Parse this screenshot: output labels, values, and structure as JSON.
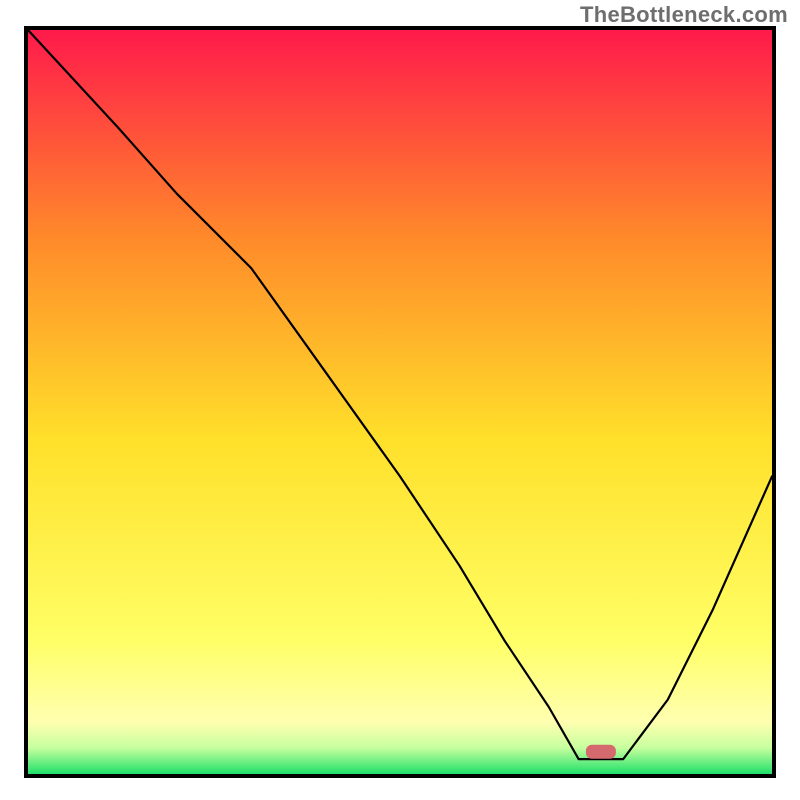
{
  "watermark": "TheBottleneck.com",
  "chart_data": {
    "type": "line",
    "title": "",
    "xlabel": "",
    "ylabel": "",
    "xlim": [
      0,
      100
    ],
    "ylim": [
      0,
      100
    ],
    "grid": false,
    "gradient_colors": {
      "top": "#ff1a4b",
      "upper_mid": "#ff8a2a",
      "mid": "#ffe02a",
      "lower_yellow": "#ffff66",
      "pale_yellow": "#ffffb0",
      "green": "#1fe06a"
    },
    "series": [
      {
        "name": "bottleneck-curve",
        "x": [
          0,
          12,
          20,
          30,
          40,
          50,
          58,
          64,
          70,
          74,
          80,
          86,
          92,
          100
        ],
        "y": [
          100,
          87,
          78,
          68,
          54,
          40,
          28,
          18,
          9,
          2,
          2,
          10,
          22,
          40
        ]
      }
    ],
    "marker": {
      "name": "optimal-point",
      "x": 77,
      "y": 3,
      "shape": "rounded-rect",
      "color": "#d46a6d"
    }
  }
}
